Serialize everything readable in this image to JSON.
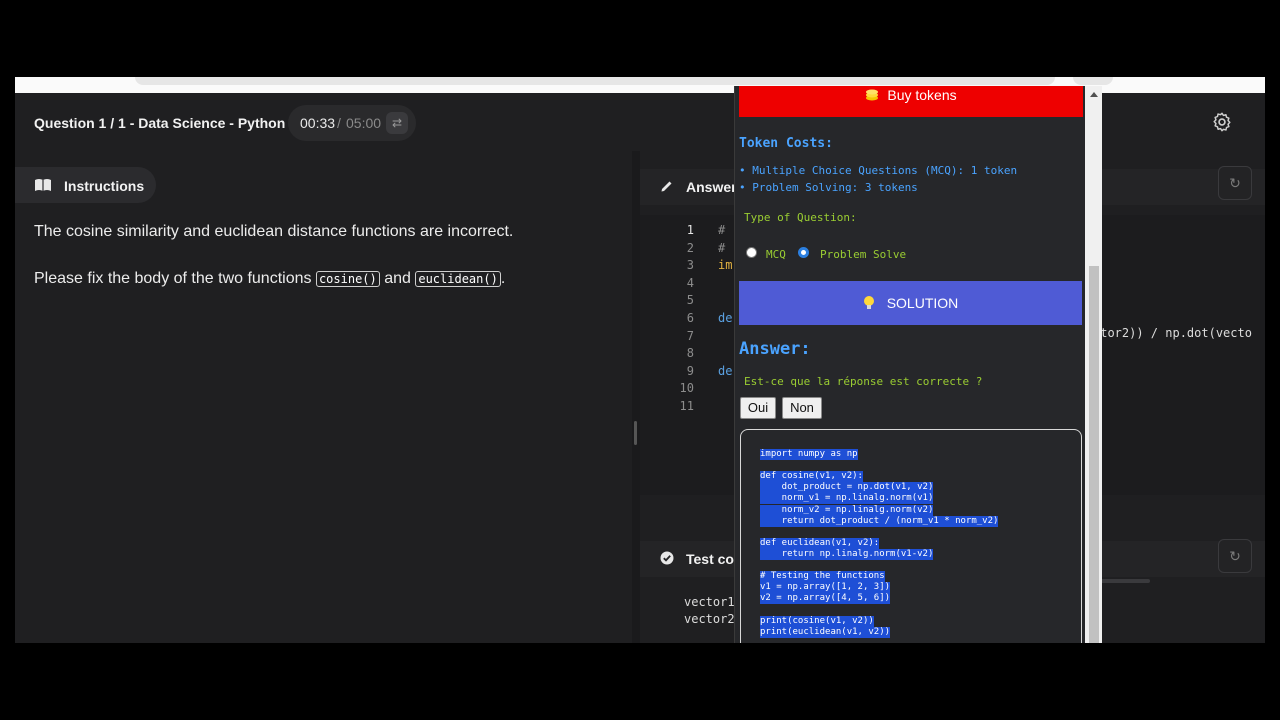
{
  "header": {
    "question_title": "Question 1 / 1 - Data Science - Python",
    "timer_elapsed": "00:33",
    "timer_separator": "/",
    "timer_total": "05:00",
    "timer_swap_icon": "⇄"
  },
  "instructions": {
    "tab_label": "Instructions",
    "p1": "The cosine similarity and euclidean distance functions are incorrect.",
    "p2_prefix": "Please fix the body of the two functions ",
    "chip1": "cosine()",
    "p2_mid": " and ",
    "chip2": "euclidean()",
    "p2_suffix": "."
  },
  "answer_panel": {
    "label": "Answer",
    "reset_icon": "↻",
    "line_numbers": [
      "1",
      "2",
      "3",
      "4",
      "5",
      "6",
      "7",
      "8",
      "9",
      "10",
      "11"
    ],
    "code_fragments": [
      "#",
      "#",
      "im",
      "",
      "",
      "de",
      "",
      "",
      "de",
      "",
      ""
    ],
    "overflow_code": "ctor2)) / np.dot(vecto"
  },
  "test_panel": {
    "label": "Test co",
    "reset_icon": "↻",
    "lines": [
      "vector1",
      "vector2"
    ]
  },
  "popup": {
    "buy_tokens": "Buy tokens",
    "token_costs_title": "Token Costs:",
    "token_lines": [
      "• Multiple Choice Questions (MCQ): 1 token",
      "• Problem Solving: 3 tokens"
    ],
    "question_type_label": "Type of Question:",
    "radio_mcq": "MCQ",
    "radio_problem": "Problem Solve",
    "solution_button": "SOLUTION",
    "answer_title": "Answer:",
    "correct_question": "Est-ce que la réponse est correcte ?",
    "yes_button": "Oui",
    "no_button": "Non",
    "solution_code": [
      "import numpy as np",
      "",
      "def cosine(v1, v2):",
      "    dot_product = np.dot(v1, v2)",
      "    norm_v1 = np.linalg.norm(v1)",
      "    norm_v2 = np.linalg.norm(v2)",
      "    return dot_product / (norm_v1 * norm_v2)",
      "",
      "def euclidean(v1, v2):",
      "    return np.linalg.norm(v1-v2)",
      "",
      "# Testing the functions",
      "v1 = np.array([1, 2, 3])",
      "v2 = np.array([4, 5, 6])",
      "",
      "print(cosine(v1, v2))",
      "print(euclidean(v1, v2))"
    ]
  },
  "colors": {
    "buy_red": "#ee0000",
    "solution_blue": "#4f5bd5",
    "token_blue": "#4aa3ff",
    "label_green": "#9acd32",
    "selection_blue": "#1e4fd6"
  },
  "icons": [
    "settings-gear-icon",
    "book-icon",
    "pencil-icon",
    "check-circle-icon",
    "coin-icon",
    "lightbulb-icon",
    "reset-icon",
    "swap-icon"
  ]
}
